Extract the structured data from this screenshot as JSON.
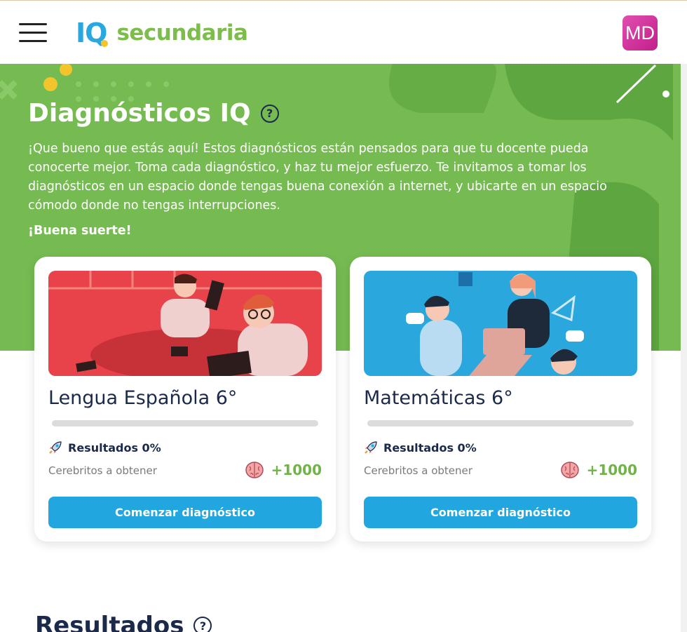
{
  "header": {
    "logo_iq_i": "I",
    "logo_iq_q": "Q",
    "logo_text": "secundaria",
    "avatar_initials": "MD"
  },
  "hero": {
    "title": "Diagnósticos IQ",
    "help_glyph": "?",
    "intro": "¡Que bueno que estás aquí! Estos diagnósticos están pensados para que tu docente pueda conocerte mejor. Toma cada diagnóstico, y haz tu mejor esfuerzo. Te invitamos a tomar los diagnósticos en un espacio donde tengas buena conexión a internet, y ubicarte en un espacio cómodo donde no tengas interrupciones.",
    "luck": "¡Buena suerte!"
  },
  "cards": [
    {
      "title": "Lengua Española 6°",
      "progress": 0,
      "results_label": "Resultados 0%",
      "brains_label": "Cerebritos a obtener",
      "brains_value": "+1000",
      "button": "Comenzar diagnóstico",
      "thumb_color": "#e8434a"
    },
    {
      "title": "Matemáticas 6°",
      "progress": 0,
      "results_label": "Resultados 0%",
      "brains_label": "Cerebritos a obtener",
      "brains_value": "+1000",
      "button": "Comenzar diagnóstico",
      "thumb_color": "#2aa7dd"
    }
  ],
  "results_section": {
    "title": "Resultados",
    "help_glyph": "?"
  },
  "colors": {
    "brand_green": "#76bb52",
    "accent_blue": "#21a6e0",
    "text_dark": "#1b2a4a",
    "avatar_pink": "#d12e9b"
  },
  "icons": [
    "menu-icon",
    "help-icon",
    "rocket-icon",
    "brain-icon"
  ]
}
